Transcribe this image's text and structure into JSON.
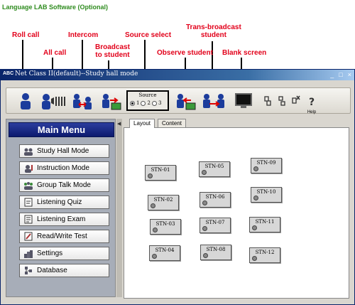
{
  "doc_title": "Language LAB Software (Optional)",
  "callouts": {
    "roll_call": "Roll call",
    "all_call": "All call",
    "intercom": "Intercom",
    "broadcast": "Broadcast\nto student",
    "source_select": "Source select",
    "trans_broadcast": "Trans-broadcast\nstudent",
    "observe": "Observe student",
    "blank_screen": "Blank screen"
  },
  "window": {
    "title": "Net Class II(default)--Study hall mode",
    "app_icon": "ABC",
    "buttons": [
      "_",
      "□",
      "×"
    ]
  },
  "toolbar": {
    "source_title": "Source",
    "source_options": [
      "1",
      "2",
      "3"
    ],
    "source_selected": "1",
    "help_label": "Help"
  },
  "menu": {
    "header": "Main Menu",
    "items": [
      {
        "label": "Study Hall Mode",
        "icon": "people-icon"
      },
      {
        "label": "Instruction Mode",
        "icon": "teacher-icon"
      },
      {
        "label": "Group Talk Mode",
        "icon": "group-icon"
      },
      {
        "label": "Listening Quiz",
        "icon": "quiz-icon"
      },
      {
        "label": "Listening Exam",
        "icon": "exam-icon"
      },
      {
        "label": "Read/Write Test",
        "icon": "pencil-icon"
      },
      {
        "label": "Settings",
        "icon": "settings-icon"
      },
      {
        "label": "Database",
        "icon": "database-icon"
      }
    ]
  },
  "tabs": [
    "Layout",
    "Content"
  ],
  "active_tab": "Layout",
  "stations": [
    "STN-01",
    "STN-02",
    "STN-03",
    "STN-04",
    "STN-05",
    "STN-06",
    "STN-07",
    "STN-08",
    "STN-09",
    "STN-10",
    "STN-11",
    "STN-12"
  ],
  "colors": {
    "callout": "#e2001a",
    "doc_title": "#2e8b1e",
    "title_bar": "#0a246a",
    "menu_header": "#1a2a8a"
  }
}
